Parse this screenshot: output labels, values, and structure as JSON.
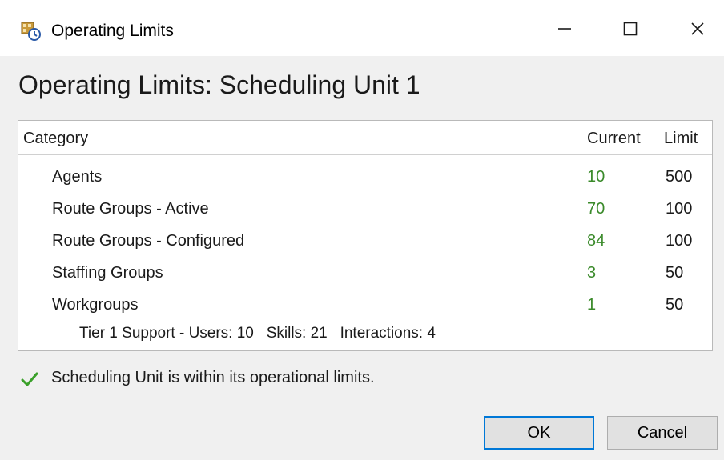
{
  "window": {
    "title": "Operating Limits",
    "icons": {
      "app": "scheduling-app-icon",
      "minimize": "minimize-icon",
      "maximize": "maximize-icon",
      "close": "close-icon"
    }
  },
  "heading": "Operating Limits: Scheduling Unit 1",
  "table": {
    "columns": {
      "category": "Category",
      "current": "Current",
      "limit": "Limit"
    },
    "rows": [
      {
        "category": "Agents",
        "current": "10",
        "limit": "500"
      },
      {
        "category": "Route Groups - Active",
        "current": "70",
        "limit": "100"
      },
      {
        "category": "Route Groups - Configured",
        "current": "84",
        "limit": "100"
      },
      {
        "category": "Staffing Groups",
        "current": "3",
        "limit": "50"
      },
      {
        "category": "Workgroups",
        "current": "1",
        "limit": "50"
      }
    ],
    "workgroup_detail": "Tier 1 Support - Users: 10   Skills: 21   Interactions: 4"
  },
  "status": {
    "icon": "check-icon",
    "message": "Scheduling Unit is within its operational limits."
  },
  "buttons": {
    "ok": "OK",
    "cancel": "Cancel"
  },
  "colors": {
    "current_value": "#3a8a2a",
    "check": "#3aa02a",
    "ok_focus_border": "#0078d7"
  }
}
